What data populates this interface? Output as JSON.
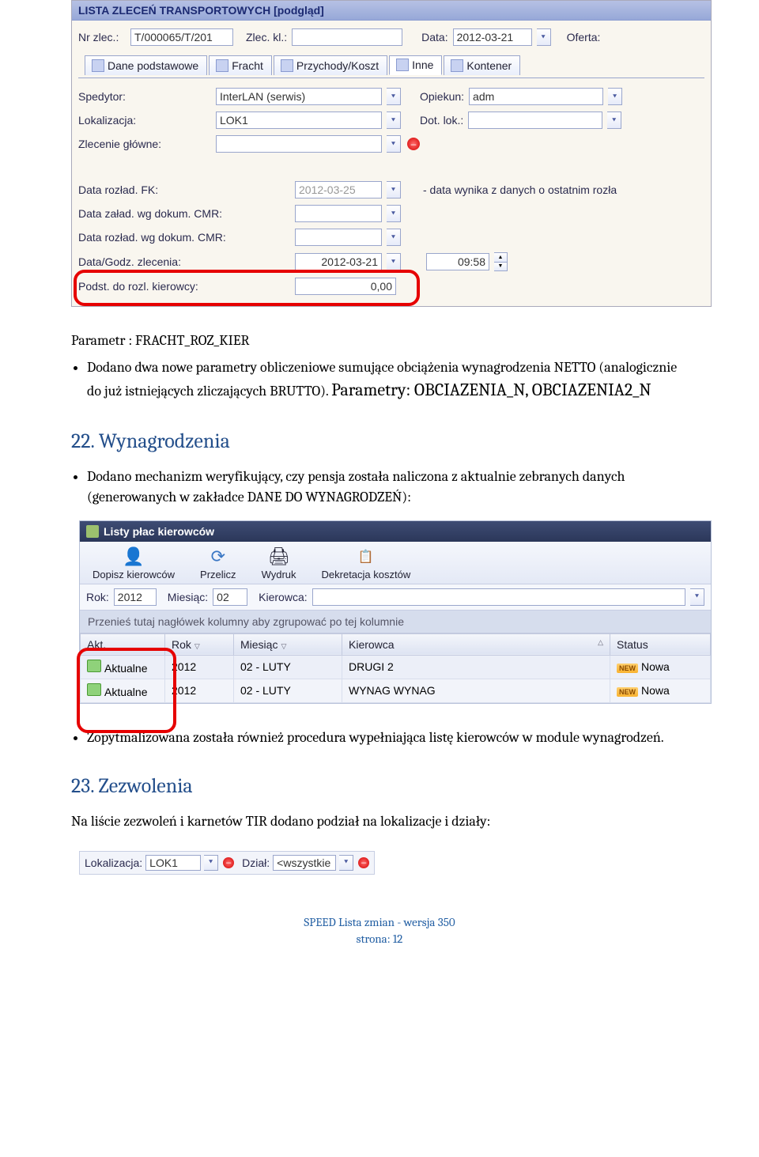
{
  "screenshot1": {
    "title": "LISTA ZLECEŃ TRANSPORTOWYCH  [podgląd]",
    "row1": {
      "nr_zlec_label": "Nr zlec.:",
      "nr_zlec_value": "T/000065/T/201",
      "zlec_kl_label": "Zlec. kl.:",
      "zlec_kl_value": "",
      "data_label": "Data:",
      "data_value": "2012-03-21",
      "oferta_label": "Oferta:"
    },
    "tabs": [
      {
        "label": "Dane podstawowe"
      },
      {
        "label": "Fracht"
      },
      {
        "label": "Przychody/Koszt"
      },
      {
        "label": "Inne"
      },
      {
        "label": "Kontener"
      }
    ],
    "panel": {
      "spedytor_label": "Spedytor:",
      "spedytor_value": "InterLAN (serwis)",
      "opiekun_label": "Opiekun:",
      "opiekun_value": "adm",
      "lokalizacja_label": "Lokalizacja:",
      "lokalizacja_value": "LOK1",
      "dot_lok_label": "Dot. lok.:",
      "dot_lok_value": "",
      "zlecenie_glowne_label": "Zlecenie główne:",
      "zlecenie_glowne_value": "",
      "data_rozlad_fk_label": "Data rozład. FK:",
      "data_rozlad_fk_value": "2012-03-25",
      "data_rozlad_fk_note": "-  data wynika z danych o ostatnim rozła",
      "data_zalad_cmr_label": "Data załad. wg dokum. CMR:",
      "data_rozlad_cmr_label": "Data rozład. wg dokum. CMR:",
      "data_godz_zlec_label": "Data/Godz. zlecenia:",
      "data_zlec_value": "2012-03-21",
      "godz_zlec_value": "09:58",
      "podst_label": "Podst. do rozl. kierowcy:",
      "podst_value": "0,00"
    }
  },
  "doc": {
    "param_line": "Parametr : FRACHT_ROZ_KIER",
    "bullet1a": "Dodano dwa nowe parametry obliczeniowe sumujące obciążenia wynagrodzenia NETTO (analogicznie do już istniejących zliczających BRUTTO). ",
    "bullet1b": "Parametry: OBCIAZENIA_N, OBCIAZENIA2_N",
    "h22": "22. Wynagrodzenia",
    "bullet2": "Dodano mechanizm weryfikujący, czy pensja została naliczona z aktualnie zebranych danych (generowanych w zakładce DANE DO WYNAGRODZEŃ):",
    "bullet3": "Zopytmalizowana została również procedura wypełniająca listę kierowców w module wynagrodzeń.",
    "h23": "23. Zezwolenia",
    "p23": "Na liście zezwoleń i karnetów TIR dodano podział na lokalizacje i działy:"
  },
  "screenshot2": {
    "title": "Listy płac kierowców",
    "toolbar": [
      {
        "label": "Dopisz kierowców"
      },
      {
        "label": "Przelicz"
      },
      {
        "label": "Wydruk"
      },
      {
        "label": "Dekretacja kosztów"
      }
    ],
    "filter": {
      "rok_label": "Rok:",
      "rok_value": "2012",
      "miesiac_label": "Miesiąc:",
      "miesiac_value": "02",
      "kierowca_label": "Kierowca:",
      "kierowca_value": ""
    },
    "group_hint": "Przenieś tutaj nagłówek kolumny aby zgrupować po tej kolumnie",
    "columns": [
      "Akt.",
      "Rok",
      "Miesiąc",
      "Kierowca",
      "Status"
    ],
    "rows": [
      {
        "akt": "Aktualne",
        "rok": "2012",
        "miesiac": "02 - LUTY",
        "kierowca": "DRUGI 2",
        "status": "Nowa"
      },
      {
        "akt": "Aktualne",
        "rok": "2012",
        "miesiac": "02 - LUTY",
        "kierowca": "WYNAG WYNAG",
        "status": "Nowa"
      }
    ]
  },
  "screenshot3": {
    "lok_label": "Lokalizacja:",
    "lok_value": "LOK1",
    "dzial_label": "Dział:",
    "dzial_value": "<wszystkie"
  },
  "footer": {
    "line1": "SPEED Lista zmian - wersja 350",
    "line2": "strona: 12"
  }
}
